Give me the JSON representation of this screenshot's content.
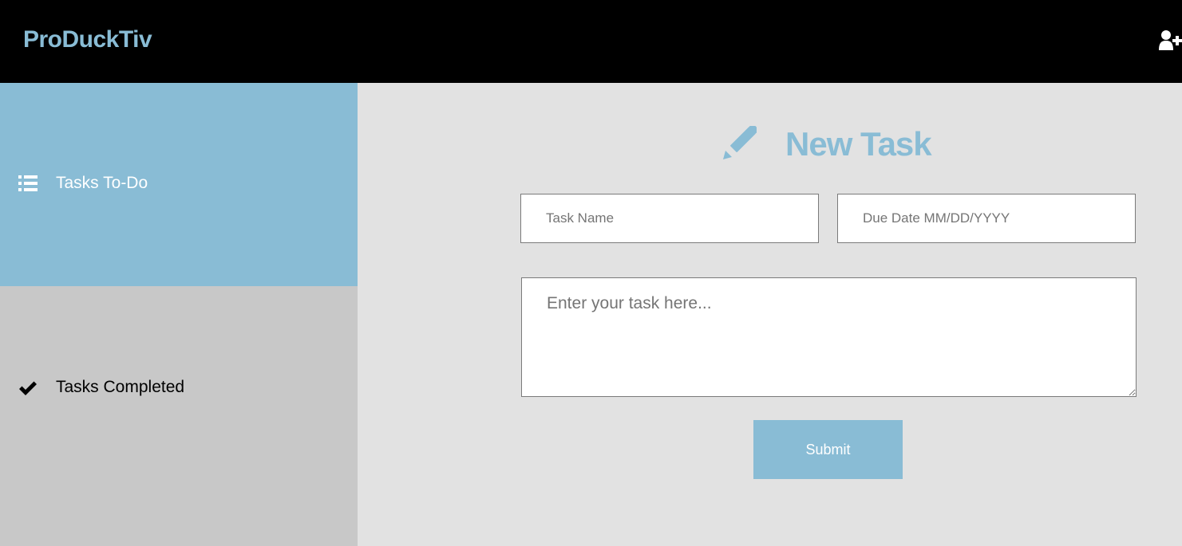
{
  "colors": {
    "header_bg": "#000000",
    "accent": "#89bcd5",
    "sidebar_active_bg": "#89bcd5",
    "sidebar_inactive_bg": "#c8c8c8",
    "main_bg": "#e2e2e2",
    "active_text": "#ffffff",
    "inactive_text": "#000000"
  },
  "header": {
    "brand": "ProDuckTiv",
    "add_user_icon": "user-plus-icon"
  },
  "sidebar": {
    "items": [
      {
        "label": "Tasks To-Do",
        "icon": "list-icon",
        "active": true
      },
      {
        "label": "Tasks Completed",
        "icon": "checkmark-icon",
        "active": false
      }
    ]
  },
  "form": {
    "title": "New Task",
    "title_icon": "pencil-icon",
    "task_name": {
      "value": "",
      "placeholder": "Task Name"
    },
    "due_date": {
      "value": "",
      "placeholder": "Due Date MM/DD/YYYY"
    },
    "description": {
      "value": "",
      "placeholder": "Enter your task here..."
    },
    "submit_label": "Submit"
  }
}
